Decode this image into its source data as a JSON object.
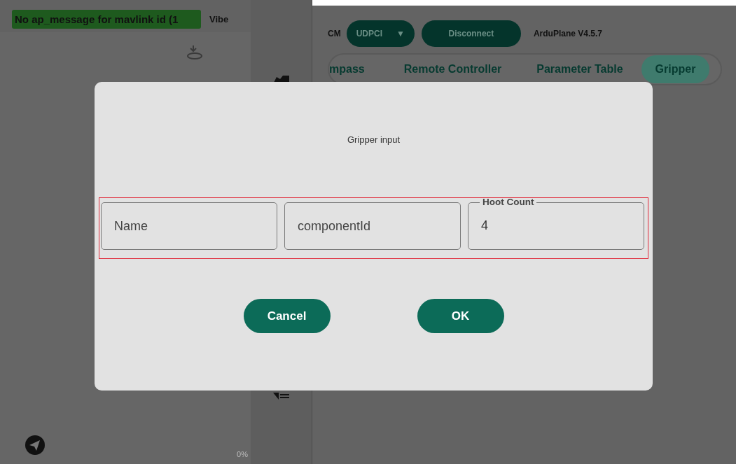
{
  "status_message": "No ap_message for mavlink id (1",
  "vibe_label": "Vibe",
  "progress_label": "0%",
  "connection": {
    "label": "CM",
    "port": "UDPCI",
    "dropdown_arrow": "▼",
    "disconnect": "Disconnect",
    "firmware": "ArduPlane V4.5.7"
  },
  "tabs": [
    {
      "label": "mpass",
      "selected": false
    },
    {
      "label": "Remote Controller",
      "selected": false
    },
    {
      "label": "Parameter Table",
      "selected": false
    },
    {
      "label": "Gripper",
      "selected": true
    }
  ],
  "dialog": {
    "title": "Gripper input",
    "fields_highlighted": true,
    "fields": [
      {
        "placeholder": "Name"
      },
      {
        "placeholder": "componentId"
      },
      {
        "label": "Hoot Count",
        "value": "4"
      }
    ],
    "buttons": [
      "Cancel",
      "OK"
    ]
  }
}
